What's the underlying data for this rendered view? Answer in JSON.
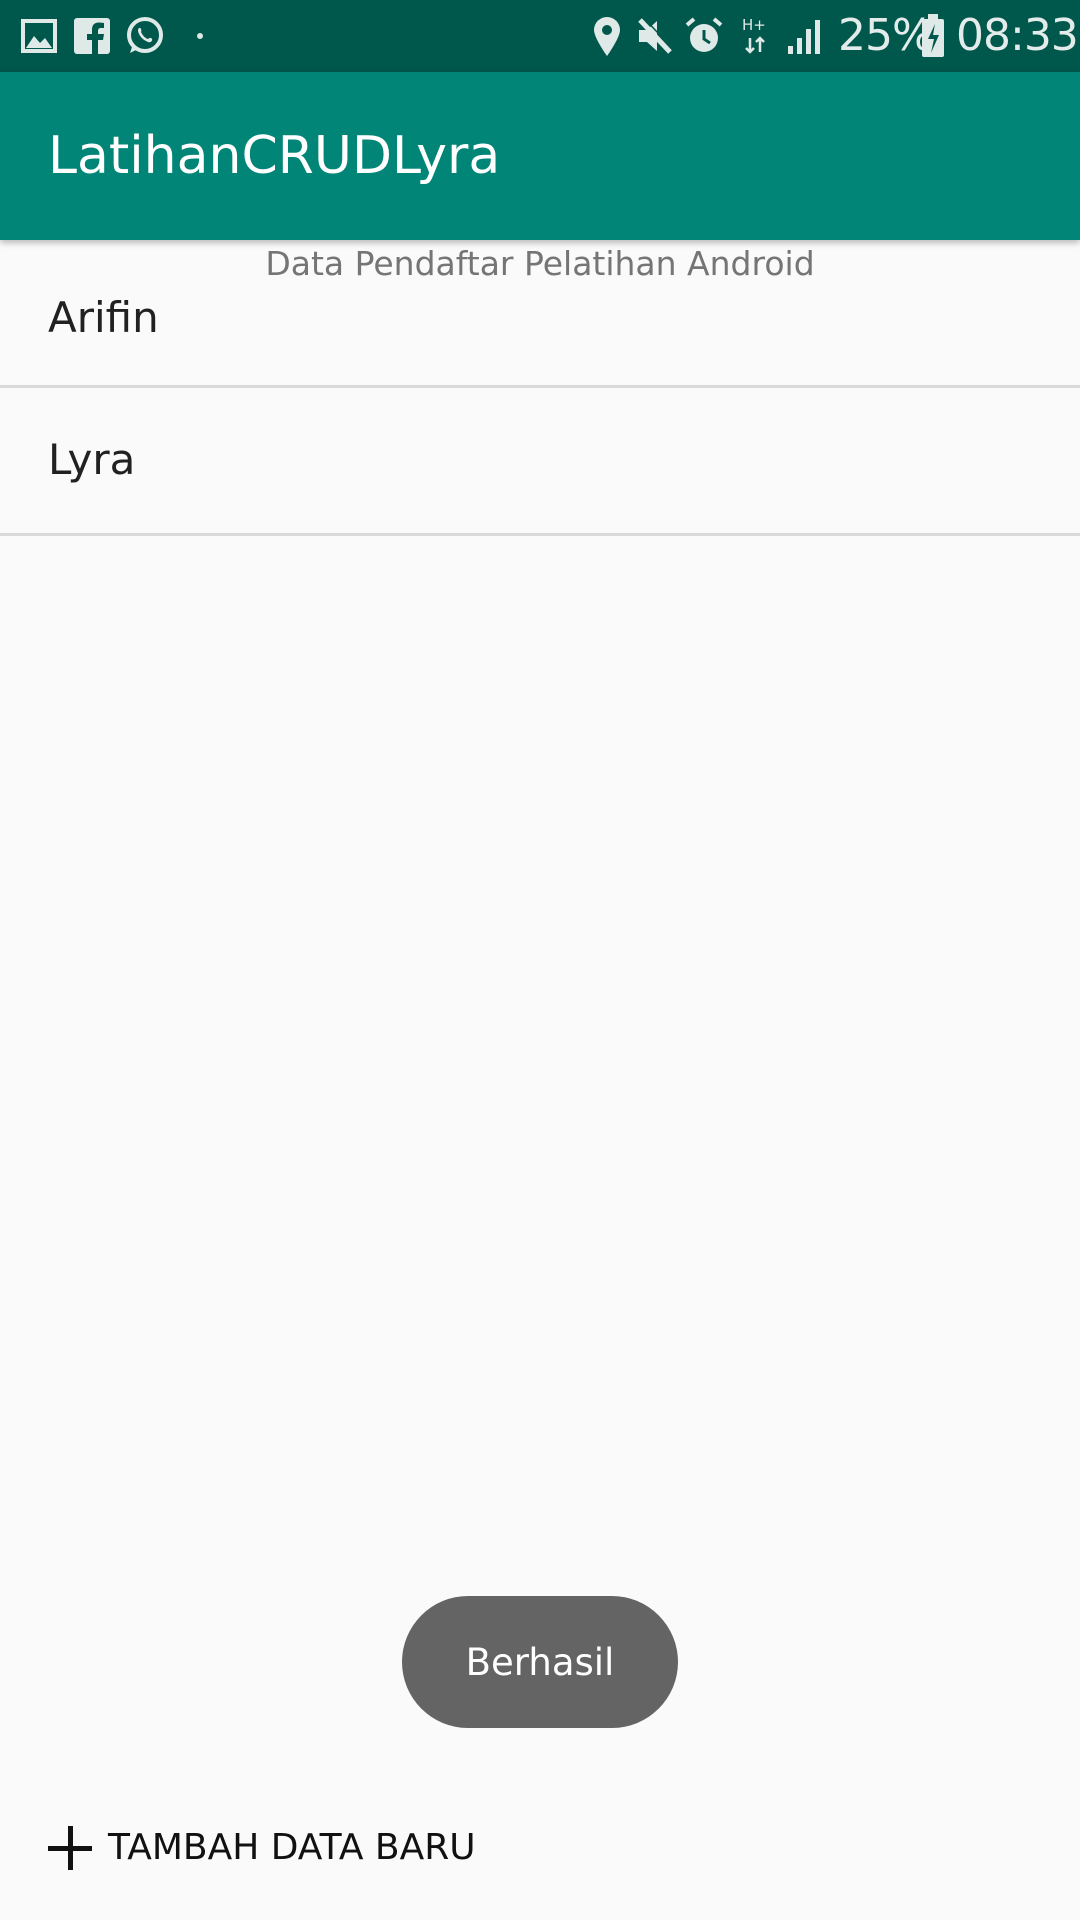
{
  "status_bar": {
    "icons_left": [
      "gallery-icon",
      "facebook-icon",
      "whatsapp-icon",
      "dot-icon"
    ],
    "icons_right": [
      "location-icon",
      "mute-icon",
      "alarm-icon",
      "network-hplus-icon",
      "signal-icon"
    ],
    "battery_percent": "25%",
    "time": "08:33"
  },
  "app_bar": {
    "title": "LatihanCRUDLyra"
  },
  "list": {
    "header": "Data Pendaftar Pelatihan Android",
    "items": [
      {
        "label": "Arifin"
      },
      {
        "label": "Lyra"
      }
    ]
  },
  "toast": {
    "message": "Berhasil"
  },
  "actions": {
    "add_label": "TAMBAH DATA BARU"
  },
  "colors": {
    "status_bar": "#00574b",
    "app_bar": "#008577",
    "background": "#fafafa",
    "toast": "#646464"
  }
}
